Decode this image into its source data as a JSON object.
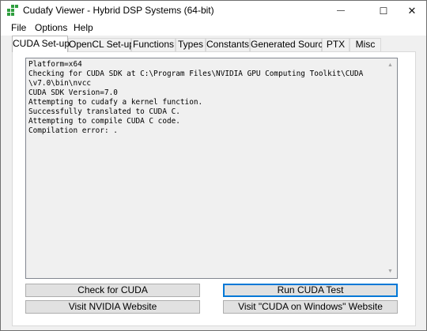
{
  "window": {
    "title": "Cudafy Viewer - Hybrid DSP Systems (64-bit)",
    "minimize_glyph": "—",
    "maximize_glyph": "☐",
    "close_glyph": "✕"
  },
  "menu": {
    "items": [
      "File",
      "Options",
      "Help"
    ]
  },
  "tabs": {
    "items": [
      "CUDA Set-up",
      "OpenCL Set-up",
      "Functions",
      "Types",
      "Constants",
      "Generated Source",
      "PTX",
      "Misc"
    ],
    "active": "CUDA Set-up"
  },
  "output": {
    "lines": [
      "Platform=x64",
      "Checking for CUDA SDK at C:\\Program Files\\NVIDIA GPU Computing Toolkit\\CUDA",
      "\\v7.0\\bin\\nvcc",
      "CUDA SDK Version=7.0",
      "Attempting to cudafy a kernel function.",
      "Successfully translated to CUDA C.",
      "Attempting to compile CUDA C code.",
      "Compilation error: ."
    ],
    "scroll_up_glyph": "▲",
    "scroll_down_glyph": "▼"
  },
  "buttons": {
    "check_cuda": "Check for CUDA",
    "run_cuda_test": "Run CUDA Test",
    "visit_nvidia": "Visit NVIDIA Website",
    "visit_cuda_on_windows": "Visit \"CUDA on Windows\" Website"
  },
  "colors": {
    "accent": "#0078d7",
    "icon_green": "#2e9e3e",
    "window_bg": "#f0f0f0"
  }
}
